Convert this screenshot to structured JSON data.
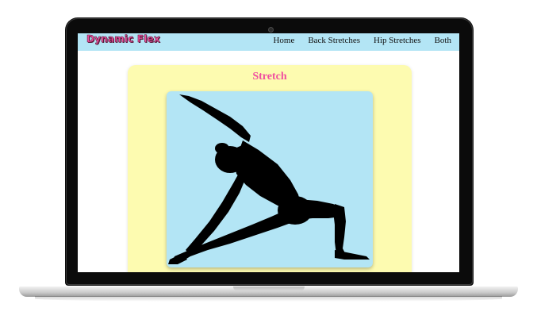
{
  "app": {
    "brand": "Dynamic Flex"
  },
  "nav": {
    "items": [
      {
        "label": "Home"
      },
      {
        "label": "Back Stretches"
      },
      {
        "label": "Hip Stretches"
      },
      {
        "label": "Both"
      }
    ]
  },
  "card": {
    "title": "Stretch"
  },
  "colors": {
    "navbar": "#b3e5f5",
    "brand": "#f04fa0",
    "card": "#fdfbb0",
    "photo_bg": "#b3e5f5",
    "silhouette": "#000000"
  },
  "icons": {
    "image": "yoga-stretch-silhouette"
  }
}
